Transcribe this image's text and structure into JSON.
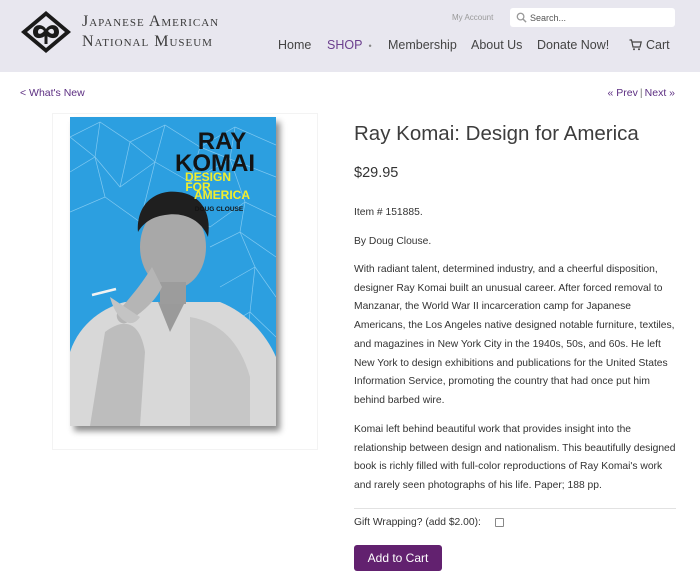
{
  "header": {
    "logo_line1": "Japanese American",
    "logo_line2": "National Museum",
    "my_account": "My Account",
    "search_placeholder": "Search...",
    "nav": [
      "Home",
      "SHOP",
      "Membership",
      "About Us",
      "Donate Now!",
      "Cart"
    ],
    "shop_marker": "•"
  },
  "breadcrumb": {
    "back_link": "< What's New",
    "prev": "« Prev",
    "separator": "|",
    "next": "Next »"
  },
  "book_cover": {
    "title_line1": "RAY",
    "title_line2": "KOMAI",
    "subtitle_line1": "DESIGN",
    "subtitle_line2": "FOR",
    "subtitle_line3": "AMERICA",
    "author": "DOUG CLOUSE"
  },
  "product": {
    "title": "Ray Komai: Design for America",
    "price": "$29.95",
    "item_number": "Item # 151885.",
    "author": "By Doug Clouse.",
    "description_1": "With radiant talent, determined industry, and a cheerful disposition, designer Ray Komai built an unusual career. After forced removal to Manzanar, the World War II incarceration camp for Japanese Americans, the Los Angeles native designed notable furniture, textiles, and magazines in New York City in the 1940s, 50s, and 60s. He left New York to design exhibitions and publications for the United States Information Service, promoting the country that had once put him behind barbed wire.",
    "description_2": "Komai left behind beautiful work that provides insight into the relationship between design and nationalism. This beautifully designed book is richly filled with full-color reproductions of Ray Komai's work and rarely seen photographs of his life. Paper; 188 pp.",
    "gift_label": "Gift Wrapping? (add $2.00):",
    "add_to_cart": "Add to Cart"
  },
  "colors": {
    "header_bg": "#e8e7ef",
    "accent": "#5c2e82",
    "button": "#62216f",
    "cover_blue": "#2c9fe0",
    "cover_yellow": "#f4ee2a"
  }
}
